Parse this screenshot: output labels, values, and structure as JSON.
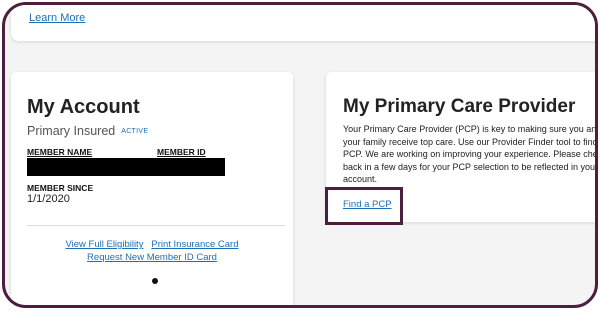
{
  "top_banner": {
    "learn_more_label": "Learn More"
  },
  "account": {
    "title": "My Account",
    "insured_type": "Primary Insured",
    "status_badge": "ACTIVE",
    "member_name_label": "MEMBER NAME",
    "member_id_label": "MEMBER ID",
    "member_since_label": "MEMBER SINCE",
    "member_since_value": "1/1/2020",
    "links": {
      "view_eligibility": "View Full Eligibility",
      "print_card": "Print Insurance Card",
      "request_card": "Request New Member ID Card"
    }
  },
  "pcp": {
    "title": "My Primary Care Provider",
    "body": "Your Primary Care Provider (PCP) is key to making sure you and your family receive top care. Use our Provider Finder tool to find a PCP. We are working on improving your experience. Please check back in a few days for your PCP selection to be reflected in your account.",
    "find_link": "Find a PCP"
  },
  "colors": {
    "frame_border": "#4b1f3d",
    "link": "#1d6fb6",
    "background": "#f4f4f5",
    "redaction": "#000000"
  }
}
